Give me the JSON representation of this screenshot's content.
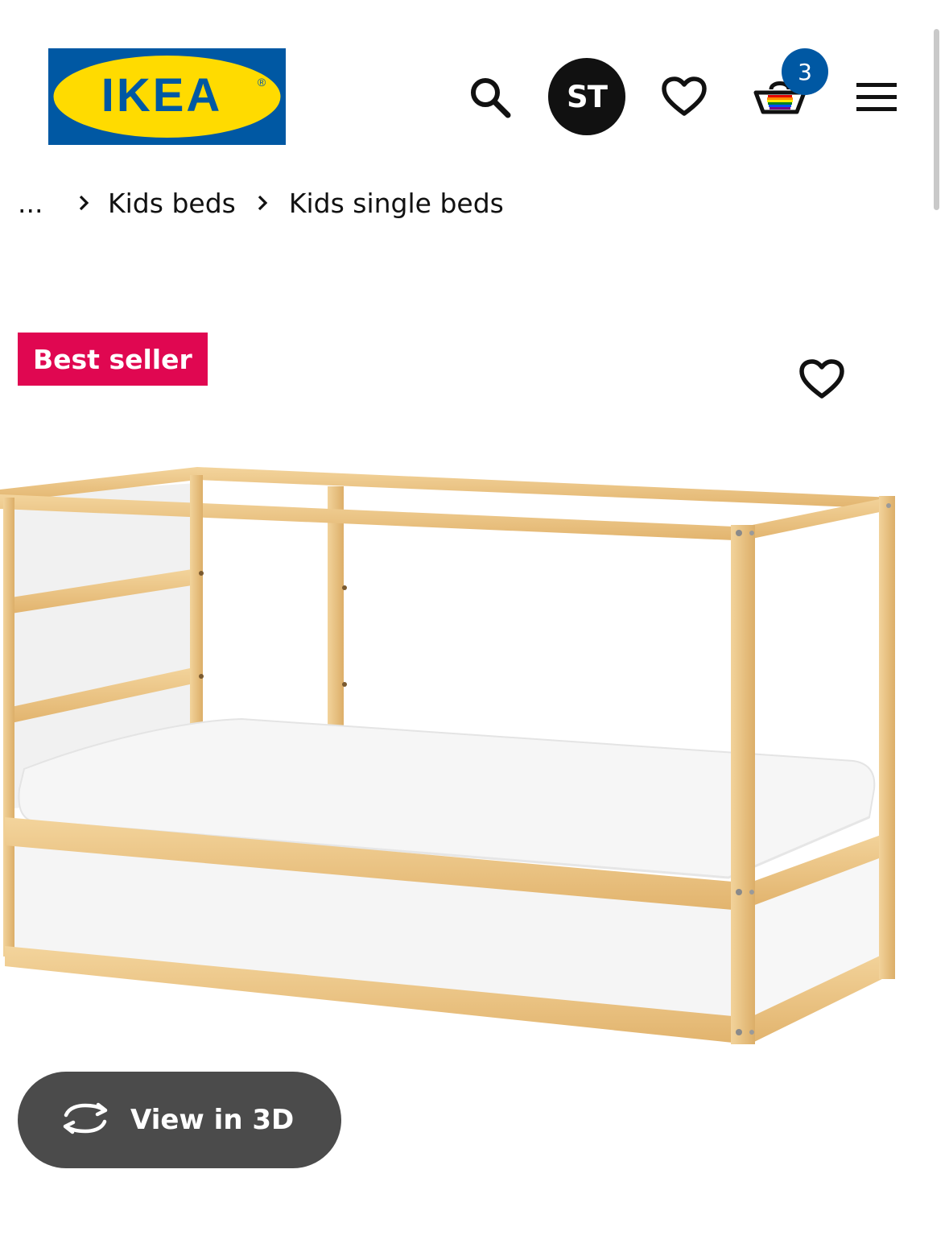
{
  "header": {
    "logo_text": "IKEA",
    "logo_registered": "®",
    "avatar_initials": "ST",
    "cart_count": "3",
    "icons": [
      "search-icon",
      "heart-icon",
      "basket-icon",
      "hamburger-menu-icon"
    ]
  },
  "breadcrumb": {
    "ellipsis": "...",
    "items": [
      "Kids beds",
      "Kids single beds"
    ]
  },
  "product": {
    "badge": "Best seller",
    "image_alt_name": "bed-image",
    "view_3d_label": "View in 3D"
  },
  "colors": {
    "ikea_blue": "#0058a3",
    "ikea_yellow": "#ffdb00",
    "best_seller": "#e00751",
    "view3d_bg": "#4b4b4b"
  }
}
